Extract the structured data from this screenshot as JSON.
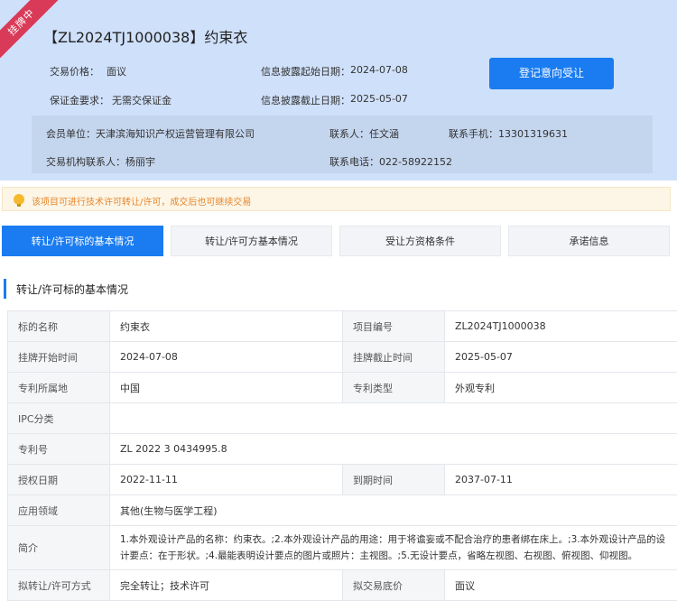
{
  "ribbon": "挂牌中",
  "title": "【ZL2024TJ1000038】约束衣",
  "info": {
    "price_label": "交易价格：",
    "price_value": "面议",
    "deposit_label": "保证金要求：",
    "deposit_value": "无需交保证金",
    "start_label": "信息披露起始日期：",
    "start_value": "2024-07-08",
    "end_label": "信息披露截止日期：",
    "end_value": "2025-05-07"
  },
  "register_button": "登记意向受让",
  "contact": {
    "member": "会员单位：天津滨海知识产权运营管理有限公司",
    "contact_person": "联系人：任文涵",
    "mobile": "联系手机：13301319631",
    "agency_contact": "交易机构联系人：杨丽宇",
    "phone": "联系电话：022-58922152"
  },
  "notice": "该项目可进行技术许可转让/许可，成交后也可继续交易",
  "tabs": [
    "转让/许可标的基本情况",
    "转让/许可方基本情况",
    "受让方资格条件",
    "承诺信息"
  ],
  "section_title": "转让/许可标的基本情况",
  "table": {
    "r1": [
      "标的名称",
      "约束衣",
      "项目编号",
      "ZL2024TJ1000038"
    ],
    "r2": [
      "挂牌开始时间",
      "2024-07-08",
      "挂牌截止时间",
      "2025-05-07"
    ],
    "r3": [
      "专利所属地",
      "中国",
      "专利类型",
      "外观专利"
    ],
    "r4": [
      "IPC分类",
      ""
    ],
    "r5": [
      "专利号",
      "ZL 2022 3 0434995.8"
    ],
    "r6": [
      "授权日期",
      "2022-11-11",
      "到期时间",
      "2037-07-11"
    ],
    "r7": [
      "应用领域",
      "其他(生物与医学工程)"
    ],
    "r8": [
      "简介",
      "1.本外观设计产品的名称：约束衣。;2.本外观设计产品的用途：用于将谵妄或不配合治疗的患者绑在床上。;3.本外观设计产品的设计要点：在于形状。;4.最能表明设计要点的图片或照片：主视图。;5.无设计要点，省略左视图、右视图、俯视图、仰视图。"
    ],
    "r9": [
      "拟转让/许可方式",
      "完全转让；技术许可",
      "拟交易底价",
      "面议"
    ]
  }
}
